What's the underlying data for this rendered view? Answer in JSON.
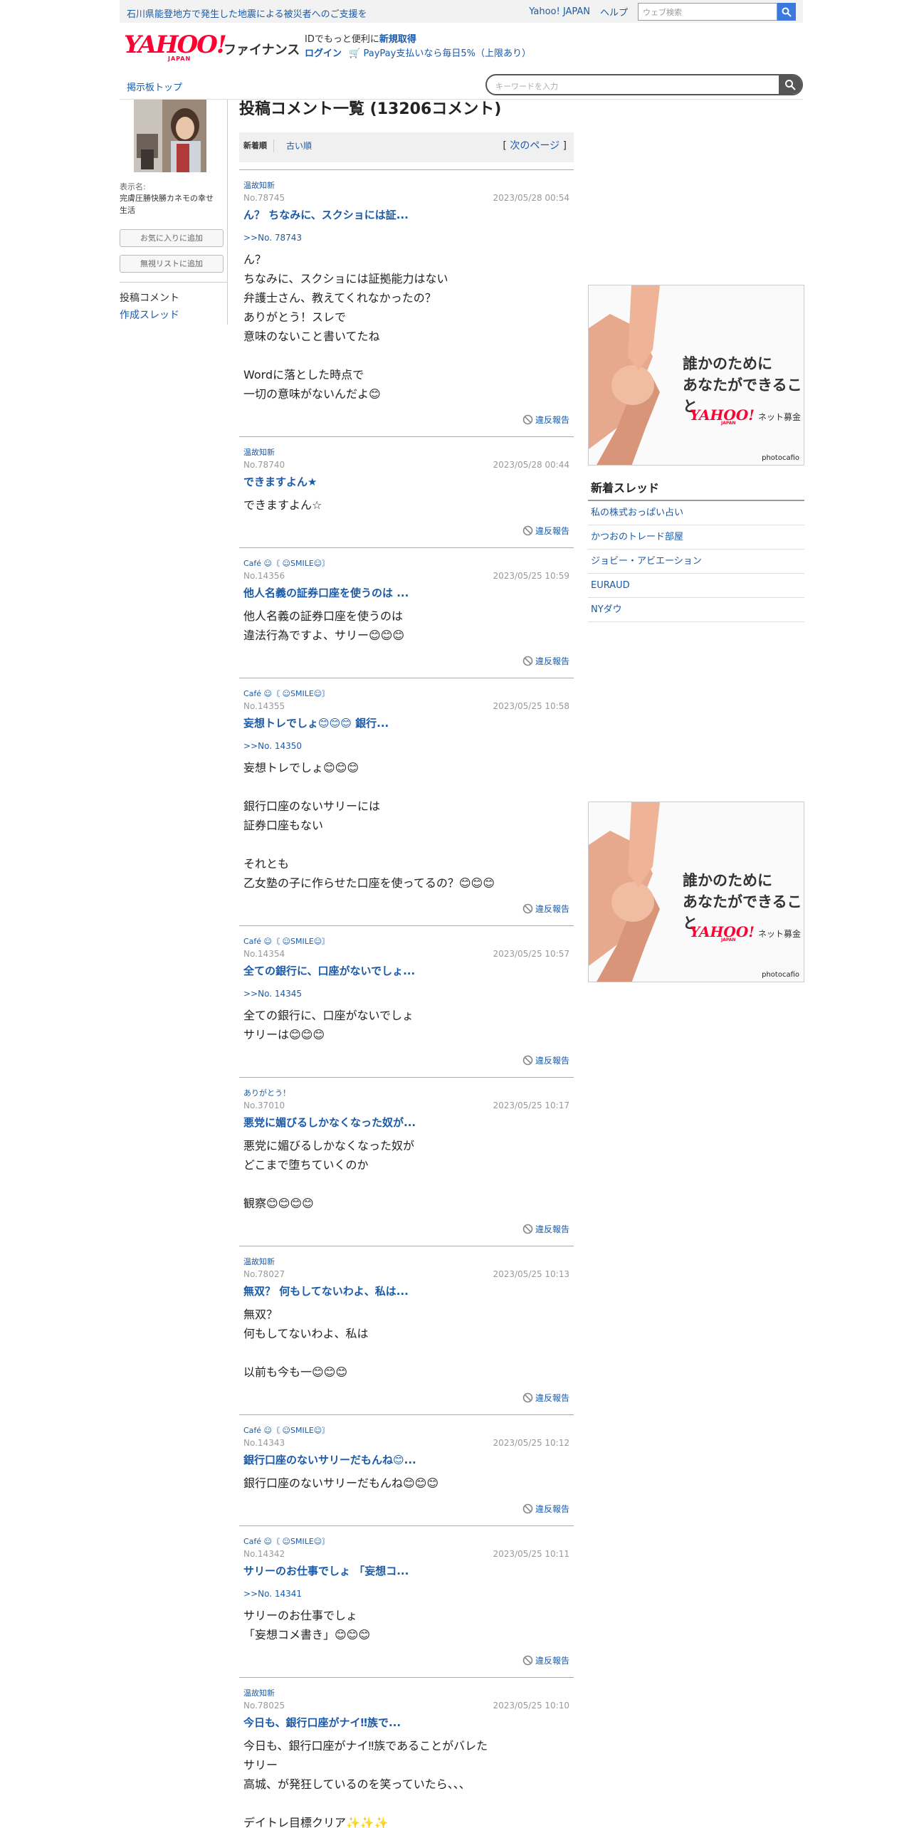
{
  "topbar": {
    "notice": "石川県能登地方で発生した地震による被災者へのご支援を",
    "yahoo_japan": "Yahoo! JAPAN",
    "help": "ヘルプ",
    "search_placeholder": "ウェブ検索"
  },
  "header": {
    "logo_text": "YAHOO!",
    "logo_sub": "JAPAN",
    "service": "ファイナンス",
    "id_prefix": "IDでもっと便利に",
    "id_link": "新規取得",
    "login": "ログイン",
    "paypay": "PayPay支払いなら毎日5%（上限あり）"
  },
  "nav": {
    "board_top": "掲示板トップ",
    "keyword_placeholder": "キーワードを入力"
  },
  "sidebar": {
    "display_name_label": "表示名:",
    "display_name": "完膚圧勝快勝カネモの幸せ生活",
    "fav_button": "お気に入りに追加",
    "ignore_button": "無視リストに追加",
    "posts_label": "投稿コメント",
    "threads_link": "作成スレッド"
  },
  "main": {
    "title": "投稿コメント一覧 (13206コメント)",
    "tab_new": "新着順",
    "tab_old": "古い順",
    "next_open": "[",
    "next_page": "次のページ",
    "next_close": "]",
    "report_label": "違反報告"
  },
  "comments": [
    {
      "author": "温故知新",
      "no": "No.78745",
      "date": "2023/05/28 00:54",
      "title": "ん？ ちなみに、スクショには証...",
      "reply": ">>No. 78743",
      "body": "ん？\nちなみに、スクショには証拠能力はない\n弁護士さん、教えてくれなかったの？\nありがとう！スレで\n意味のないこと書いてたね\n\nWordに落とした時点で\n一切の意味がないんだよ😊"
    },
    {
      "author": "温故知新",
      "no": "No.78740",
      "date": "2023/05/28 00:44",
      "title": "できますよん★",
      "reply": "",
      "body": "できますよん☆"
    },
    {
      "author": "Café ☺︎〘 ☺SMILE☺〙",
      "no": "No.14356",
      "date": "2023/05/25 10:59",
      "title": "他人名義の証券口座を使うのは ...",
      "reply": "",
      "body": "他人名義の証券口座を使うのは\n違法行為ですよ、サリー😊😊😊"
    },
    {
      "author": "Café ☺︎〘 ☺SMILE☺〙",
      "no": "No.14355",
      "date": "2023/05/25 10:58",
      "title": "妄想トレでしょ😊😊😊 銀行...",
      "reply": ">>No. 14350",
      "body": "妄想トレでしょ😊😊😊\n\n銀行口座のないサリーには\n証券口座もない\n\nそれとも\n乙女塾の子に作らせた口座を使ってるの？😊😊😊"
    },
    {
      "author": "Café ☺︎〘 ☺SMILE☺〙",
      "no": "No.14354",
      "date": "2023/05/25 10:57",
      "title": "全ての銀行に、口座がないでしょ...",
      "reply": ">>No. 14345",
      "body": "全ての銀行に、口座がないでしょ\nサリーは😊😊😊"
    },
    {
      "author": "ありがとう！",
      "no": "No.37010",
      "date": "2023/05/25 10:17",
      "title": "悪党に媚びるしかなくなった奴が...",
      "reply": "",
      "body": "悪党に媚びるしかなくなった奴が\nどこまで堕ちていくのか\n\n観察😊😊😊😊"
    },
    {
      "author": "温故知新",
      "no": "No.78027",
      "date": "2023/05/25 10:13",
      "title": "無双？ 何もしてないわよ、私は...",
      "reply": "",
      "body": "無双？\n何もしてないわよ、私は\n\n以前も今も一😊😊😊"
    },
    {
      "author": "Café ☺︎〘 ☺SMILE☺〙",
      "no": "No.14343",
      "date": "2023/05/25 10:12",
      "title": "銀行口座のないサリーだもんね😊...",
      "reply": "",
      "body": "銀行口座のないサリーだもんね😊😊😊"
    },
    {
      "author": "Café ☺︎〘 ☺SMILE☺〙",
      "no": "No.14342",
      "date": "2023/05/25 10:11",
      "title": "サリーのお仕事でしょ 「妄想コ...",
      "reply": ">>No. 14341",
      "body": "サリーのお仕事でしょ\n「妄想コメ書き」😊😊😊"
    },
    {
      "author": "温故知新",
      "no": "No.78025",
      "date": "2023/05/25 10:10",
      "title": "今日も、銀行口座がナイ‼︎族で...",
      "reply": "",
      "body": "今日も、銀行口座がナイ‼︎族であることがバレた\nサリー\n高城、が発狂しているのを笑っていたら、、、\n\nデイトレ目標クリア✨✨✨\n長期分も、少し売買してお手入れ😊"
    }
  ],
  "ads": [
    {
      "line1": "誰かのために",
      "line2": "あなたができること",
      "brand": "YAHOO!",
      "brand_sub": "JAPAN",
      "tag": "ネット募金",
      "credit": "photocafio"
    },
    {
      "line1": "誰かのために",
      "line2": "あなたができること",
      "brand": "YAHOO!",
      "brand_sub": "JAPAN",
      "tag": "ネット募金",
      "credit": "photocafio"
    }
  ],
  "new_threads": {
    "heading": "新着スレッド",
    "items": [
      "私の株式おっぱい占い",
      "かつおのトレード部屋",
      "ジョビー・アビエーション",
      "EURAUD",
      "NYダウ"
    ]
  },
  "colors": {
    "link": "#1a5aa8",
    "brand_red": "#ff0033",
    "search_blue": "#3b79e0"
  }
}
